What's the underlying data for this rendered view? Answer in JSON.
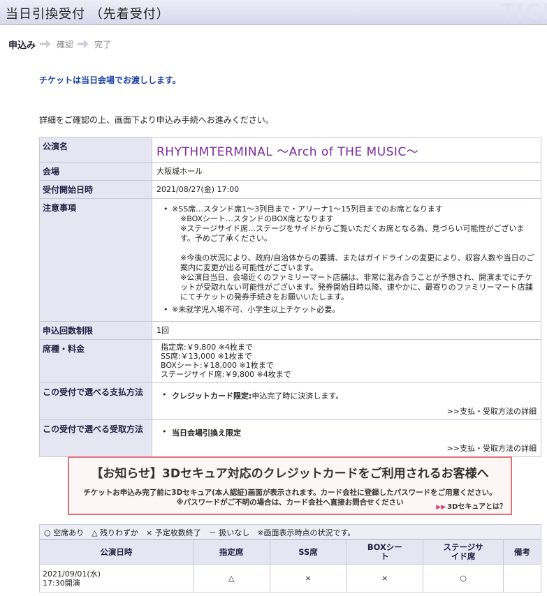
{
  "page": {
    "title": "当日引換受付 （先着受付）",
    "logo_fragment": "TICI"
  },
  "steps": {
    "apply": "申込み",
    "confirm": "確認",
    "complete": "完了"
  },
  "notice_blue": "チケットは当日会場でお渡しします。",
  "intro_text": "詳細をご確認の上、画面下より申込み手続へお進みください。",
  "info": {
    "performance_label": "公演名",
    "performance_value": "RHYTHMTERMINAL ～Arch of THE MUSIC～",
    "venue_label": "会場",
    "venue_value": "大阪城ホール",
    "start_label": "受付開始日時",
    "start_value": "2021/08/27(金) 17:00",
    "notes_label": "注意事項",
    "notes": [
      "※SS席…スタンド席1～3列目まで・アリーナ1～15列目までのお席となります",
      "※BOXシート…スタンドのBOX席となります",
      "※ステージサイド席…ステージをサイドからご覧いただくお席となる為、見づらい可能性がございます。予めご了承ください。",
      "※今後の状況により、政府/自治体からの要請、またはガイドラインの変更により、収容人数や当日のご案内に変更が出る可能性がございます。",
      "※公演日当日、会場近くのファミリーマート店舗は、非常に混み合うことが予想され、開演までにチケットが受取れない可能性がございます。発券開始日時以降、速やかに、最寄りのファミリーマート店舗にてチケットの発券手続きをお願いいたします。",
      "※未就学児入場不可、小学生以上チケット必要。"
    ],
    "limit_label": "申込回数制限",
    "limit_value": "1回",
    "price_label": "席種・料金",
    "prices": [
      "指定席:￥9,800 ※4枚まで",
      "SS席:￥13,000 ※1枚まで",
      "BOXシート:￥18,000 ※1枚まで",
      "ステージサイド席:￥9,800 ※4枚まで"
    ],
    "payment_label": "この受付で選べる支払方法",
    "payment_bold": "クレジットカード限定:",
    "payment_text": "申込完了時に決済します。",
    "payment_link": ">>支払・受取方法の詳細",
    "receive_label": "この受付で選べる受取方法",
    "receive_bold": "当日会場引換え限定",
    "receive_link": ">>支払・受取方法の詳細"
  },
  "banner": {
    "title": "【お知らせ】3Dセキュア対応のクレジットカードをご利用されるお客様へ",
    "line1": "チケットお申込み完了前に3Dセキュア(本人認証)画面が表示されます。カード会社に登録したパスワードをご用意ください。",
    "line2": "※パスワードがご不明の場合は、カード会社へ直接お問合せください",
    "link": "3Dセキュアとは？",
    "accent_color": "#e0707a"
  },
  "legend": "○ 空席あり　△ 残りわずか　× 予定枚数終了　－ 扱いなし　※画面表示時点の状況です。",
  "availability": {
    "headers": [
      "公演日時",
      "指定席",
      "SS席",
      "BOXシート",
      "ステージサイド席",
      "備考"
    ],
    "header_lines": [
      [
        "公演日時"
      ],
      [
        "指定席"
      ],
      [
        "SS席"
      ],
      [
        "BOXシー",
        "ト"
      ],
      [
        "ステージサ",
        "イド席"
      ],
      [
        "備考"
      ]
    ],
    "rows": [
      {
        "date": "2021/09/01(水)",
        "time": "17:30開演",
        "cells": [
          "△",
          "×",
          "×",
          "○",
          ""
        ]
      }
    ]
  }
}
